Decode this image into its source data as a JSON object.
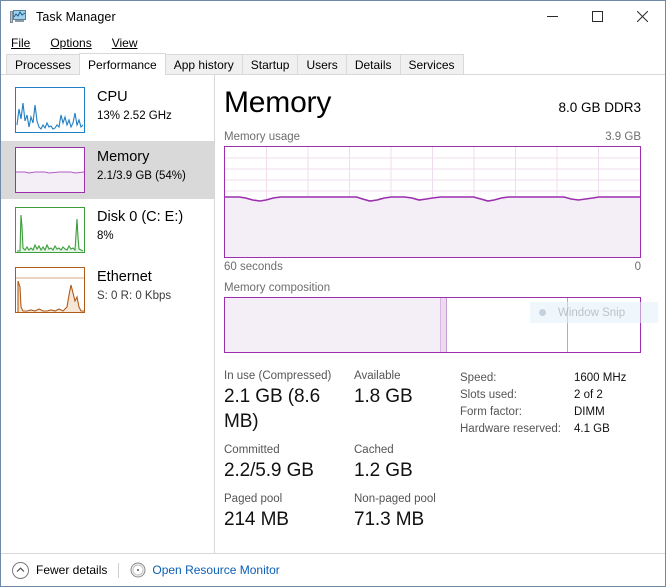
{
  "window": {
    "title": "Task Manager",
    "icon": "task-manager-icon",
    "controls": {
      "minimize": "–",
      "maximize": "□",
      "close": "✕"
    }
  },
  "menu": [
    {
      "label": "File",
      "accel": "F"
    },
    {
      "label": "Options",
      "accel": "O"
    },
    {
      "label": "View",
      "accel": "V"
    }
  ],
  "tabs": [
    {
      "label": "Processes",
      "active": false
    },
    {
      "label": "Performance",
      "active": true
    },
    {
      "label": "App history",
      "active": false
    },
    {
      "label": "Startup",
      "active": false
    },
    {
      "label": "Users",
      "active": false
    },
    {
      "label": "Details",
      "active": false
    },
    {
      "label": "Services",
      "active": false
    }
  ],
  "sidebar": {
    "items": [
      {
        "name": "CPU",
        "detail": "13%  2.52 GHz",
        "color": "#1f7fc4",
        "selected": false
      },
      {
        "name": "Memory",
        "detail": "2.1/3.9 GB (54%)",
        "color": "#9b2fae",
        "selected": true
      },
      {
        "name": "Disk 0 (C: E:)",
        "detail": "8%",
        "color": "#3a9e3a",
        "selected": false
      },
      {
        "name": "Ethernet",
        "detail": "S: 0 R: 0 Kbps",
        "color": "#b05a18",
        "selected": false
      }
    ]
  },
  "main": {
    "title": "Memory",
    "subtitle": "8.0 GB DDR3",
    "usage_caption": "Memory usage",
    "usage_max": "3.9 GB",
    "axis_left": "60 seconds",
    "axis_right": "0",
    "composition_caption": "Memory composition",
    "graph_color": "#9b2fae",
    "stats": [
      [
        {
          "label": "In use (Compressed)",
          "value": "2.1 GB (8.6 MB)"
        },
        {
          "label": "Available",
          "value": "1.8 GB"
        }
      ],
      [
        {
          "label": "Committed",
          "value": "2.2/5.9 GB"
        },
        {
          "label": "Cached",
          "value": "1.2 GB"
        }
      ],
      [
        {
          "label": "Paged pool",
          "value": "214 MB"
        },
        {
          "label": "Non-paged pool",
          "value": "71.3 MB"
        }
      ]
    ],
    "details": [
      {
        "key": "Speed:",
        "value": "1600 MHz"
      },
      {
        "key": "Slots used:",
        "value": "2 of 2"
      },
      {
        "key": "Form factor:",
        "value": "DIMM"
      },
      {
        "key": "Hardware reserved:",
        "value": "4.1 GB"
      }
    ],
    "overlay": {
      "label": "Window Snip"
    }
  },
  "chart_data": {
    "type": "area",
    "title": "Memory usage",
    "xlabel": "",
    "ylabel": "",
    "ylim": [
      0,
      3.9
    ],
    "yunit": "GB",
    "xlim": [
      60,
      0
    ],
    "xunit": "seconds",
    "grid": true,
    "grid_cols": 10,
    "grid_rows": 10,
    "series": [
      {
        "name": "Memory in use",
        "color": "#9b2fae",
        "values": [
          2.12,
          2.12,
          2.11,
          2.1,
          2.09,
          2.08,
          2.09,
          2.11,
          2.12,
          2.12,
          2.12,
          2.12,
          2.12,
          2.12,
          2.12,
          2.12,
          2.12,
          2.12,
          2.12,
          2.12,
          2.12,
          2.11,
          2.1,
          2.09,
          2.1,
          2.12,
          2.12,
          2.12,
          2.11,
          2.1,
          2.11,
          2.12,
          2.12,
          2.12,
          2.12,
          2.12,
          2.12,
          2.11,
          2.09,
          2.1,
          2.12,
          2.12,
          2.12,
          2.12,
          2.12,
          2.12,
          2.12,
          2.12,
          2.12,
          2.12,
          2.12,
          2.12,
          2.12,
          2.11,
          2.1,
          2.1,
          2.11,
          2.12,
          2.12,
          2.12,
          2.12
        ]
      }
    ]
  },
  "composition": {
    "segments": [
      {
        "name": "in-use",
        "percent": 52.0,
        "filled": true
      },
      {
        "name": "modified",
        "percent": 1.6,
        "filled": true
      },
      {
        "name": "standby",
        "percent": 29.0,
        "filled": false
      },
      {
        "name": "free",
        "percent": 17.4,
        "filled": false
      }
    ]
  },
  "footer": {
    "fewer_details": "Fewer details",
    "fewer_details_accel": "d",
    "open_resource_monitor": "Open Resource Monitor"
  }
}
